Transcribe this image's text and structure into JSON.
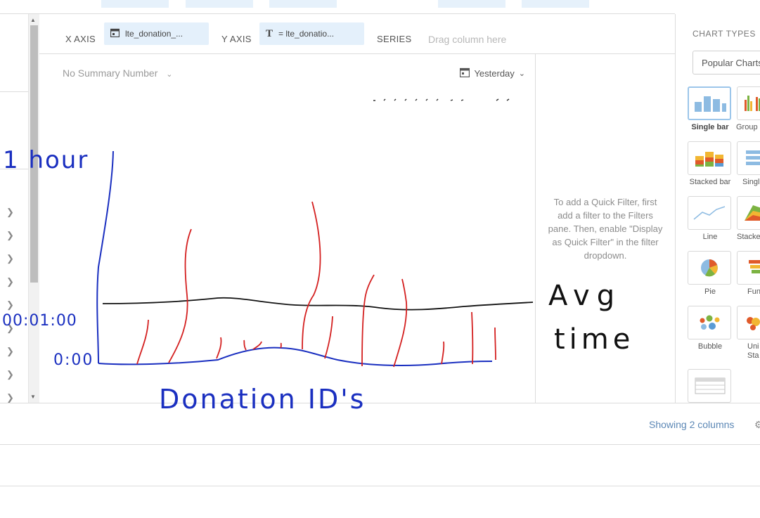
{
  "toolbar": {
    "x_axis_label": "X AXIS",
    "x_axis_value": "lte_donation_...",
    "y_axis_label": "Y AXIS",
    "y_axis_value": "= lte_donatio...",
    "y_axis_icon_glyph": "T",
    "series_label": "SERIES",
    "series_placeholder": "Drag column here"
  },
  "chart": {
    "summary": "No Summary Number",
    "date_filter": "Yesterday"
  },
  "quick_filter_hint": "To add a Quick Filter, first add a filter to the Filters pane. Then, enable \"Display as Quick Filter\" in the filter dropdown.",
  "chart_types": {
    "title": "CHART TYPES",
    "dropdown_value": "Popular Charts",
    "items": [
      {
        "label": "Single bar",
        "selected": true
      },
      {
        "label": "Group"
      },
      {
        "label": "Stacked bar"
      },
      {
        "label": "Singl"
      },
      {
        "label": "Line"
      },
      {
        "label": "Stacke"
      },
      {
        "label": "Pie"
      },
      {
        "label": "Fun"
      },
      {
        "label": "Bubble"
      },
      {
        "label": "Uni"
      },
      {
        "label": "Sta"
      }
    ]
  },
  "footer": {
    "showing": "Showing 2 columns"
  },
  "annotation": {
    "y_top": "1 hour",
    "y_mid": "00:01:00",
    "y_zero": "0:00",
    "x_label": "Donation ID's",
    "avg_label_1": "Avg",
    "avg_label_2": "time"
  },
  "colors": {
    "accent": "#e4f0fb",
    "link": "#5b87b5",
    "ink_blue": "#1a2fc0",
    "ink_red": "#d42020",
    "ink_black": "#111111"
  }
}
